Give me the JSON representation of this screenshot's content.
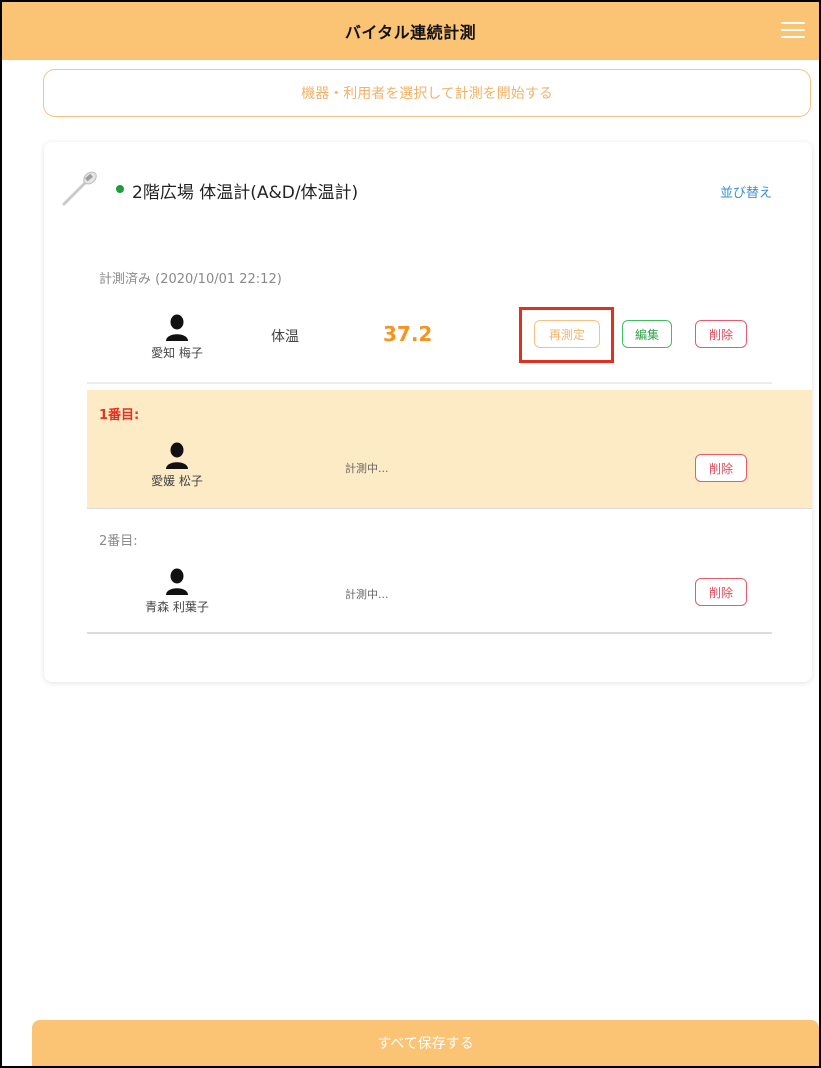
{
  "header": {
    "title": "バイタル連続計測"
  },
  "select_button": {
    "label": "機器・利用者を選択して計測を開始する"
  },
  "device": {
    "name": "2階広場 体温計(A&D/体温計)",
    "status_color": "#1f9d3a",
    "sort_label": "並び替え"
  },
  "measured": {
    "label": "計測済み (2020/10/01 22:12)",
    "person": "愛知 梅子",
    "metric_label": "体温",
    "metric_value": "37.2",
    "buttons": {
      "remeasure": "再測定",
      "edit": "編集",
      "delete": "削除"
    }
  },
  "queue": [
    {
      "label": "1番目:",
      "person": "愛媛 松子",
      "status": "計測中...",
      "delete": "削除"
    },
    {
      "label": "2番目:",
      "person": "青森 利葉子",
      "status": "計測中...",
      "delete": "削除"
    }
  ],
  "footer": {
    "save_label": "すべて保存する"
  },
  "colors": {
    "accent": "#fbc374",
    "value": "#f7931e",
    "highlight": "#e2301e"
  },
  "icons": {
    "menu": "hamburger-menu-icon",
    "device": "thermometer-icon",
    "avatar": "person-silhouette-icon"
  }
}
